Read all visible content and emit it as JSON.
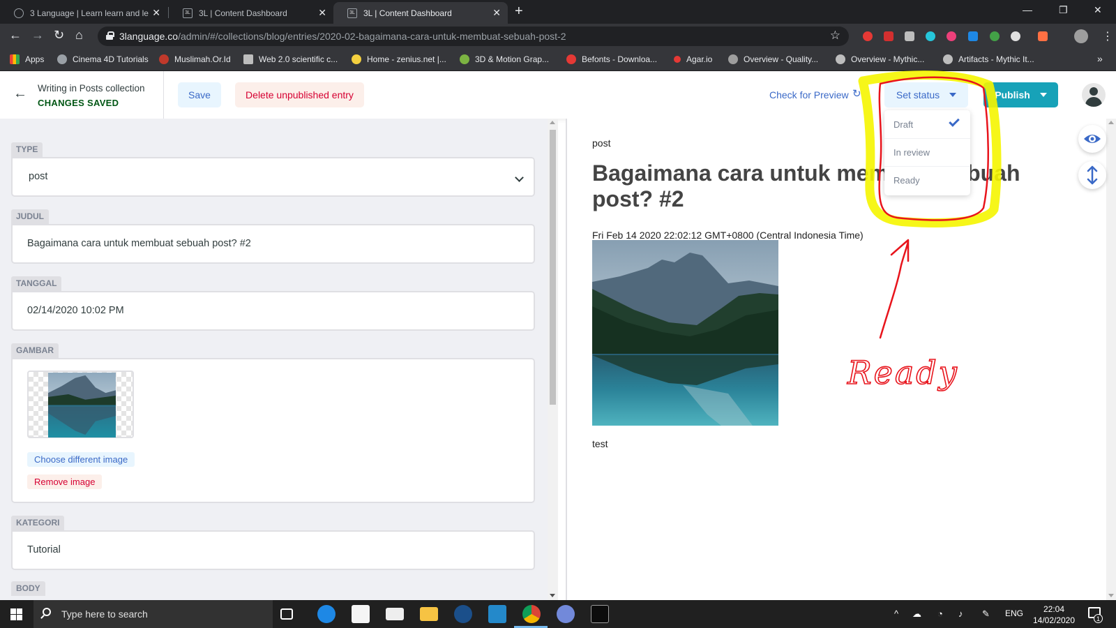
{
  "browser": {
    "tabs": [
      {
        "title": "3 Language | Learn learn and lea",
        "favicon": "globe-icon"
      },
      {
        "title": "3L | Content Dashboard",
        "favicon": "3l-icon"
      },
      {
        "title": "3L | Content Dashboard",
        "favicon": "3l-icon",
        "active": true
      }
    ],
    "url_host": "3language.co",
    "url_path": "/admin/#/collections/blog/entries/2020-02-bagaimana-cara-untuk-membuat-sebuah-post-2",
    "bookmarks": [
      {
        "label": "Apps",
        "color": "#ea4335"
      },
      {
        "label": "Cinema 4D Tutorials",
        "color": "#9aa0a6"
      },
      {
        "label": "Muslimah.Or.Id",
        "color": "#c0392b"
      },
      {
        "label": "Web 2.0 scientific c...",
        "color": "#bdbdbd"
      },
      {
        "label": "Home - zenius.net |...",
        "color": "#f4d03f"
      },
      {
        "label": "3D & Motion Grap...",
        "color": "#7cb342"
      },
      {
        "label": "Befonts - Downloa...",
        "color": "#e53935"
      },
      {
        "label": "Agar.io",
        "color": "#e53935"
      },
      {
        "label": "Overview - Quality...",
        "color": "#9e9e9e"
      },
      {
        "label": "Overview - Mythic...",
        "color": "#bdbdbd"
      },
      {
        "label": "Artifacts - Mythic It...",
        "color": "#bdbdbd"
      }
    ]
  },
  "cms": {
    "breadcrumb": "Writing in Posts collection",
    "save_state": "CHANGES SAVED",
    "save_label": "Save",
    "delete_label": "Delete unpublished entry",
    "preview_label": "Check for Preview",
    "status_label": "Set status",
    "publish_label": "Publish",
    "status_options": [
      {
        "label": "Draft",
        "selected": true
      },
      {
        "label": "In review",
        "selected": false
      },
      {
        "label": "Ready",
        "selected": false
      }
    ],
    "accent_color": "#3a69c7",
    "publish_color": "#17a2b8"
  },
  "editor": {
    "type_label": "TYPE",
    "type_value": "post",
    "title_label": "JUDUL",
    "title_value": "Bagaimana cara untuk membuat sebuah post? #2",
    "date_label": "TANGGAL",
    "date_value": "02/14/2020 10:02 PM",
    "image_label": "GAMBAR",
    "choose_image": "Choose different image",
    "remove_image": "Remove image",
    "category_label": "KATEGORI",
    "category_value": "Tutorial",
    "body_label": "BODY"
  },
  "preview": {
    "type": "post",
    "title": "Bagaimana cara untuk membuat sebuah post? #2",
    "date": "Fri Feb 14 2020 22:02:12 GMT+0800 (Central Indonesia Time)",
    "body": "test"
  },
  "annotation": {
    "handwritten_text": "Ready",
    "highlight_color": "#f5f500",
    "ink_color": "#e8141c"
  },
  "taskbar": {
    "search_placeholder": "Type here to search",
    "language": "ENG",
    "time": "22:04",
    "date": "14/02/2020",
    "notification_count": "1"
  }
}
